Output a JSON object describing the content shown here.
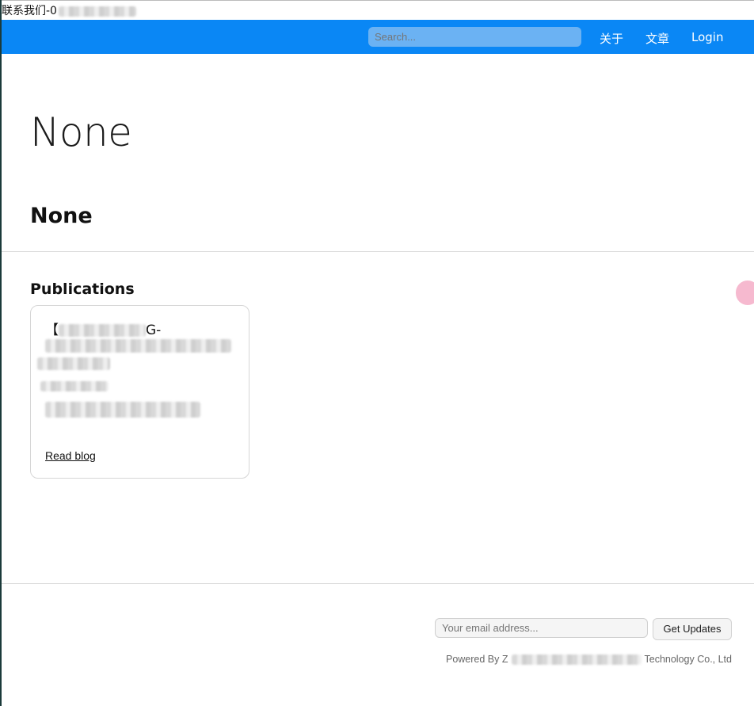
{
  "contact_bar": {
    "text": "联系我们-0"
  },
  "navbar": {
    "search_placeholder": "Search...",
    "links": [
      "关于",
      "文章",
      "Login"
    ]
  },
  "main": {
    "heading": "None",
    "subheading": "None",
    "publications_title": "Publications",
    "card": {
      "title_fragment_1": "【",
      "title_fragment_2": "G-",
      "read_link": "Read blog"
    }
  },
  "footer": {
    "email_placeholder": "Your email address...",
    "submit_label": "Get Updates",
    "powered_prefix": "Powered By Z",
    "powered_suffix": "Technology Co., Ltd"
  },
  "colors": {
    "navbar": "#0a87f5",
    "search_bg": "#6bb2f3",
    "side_widget": "#f6b9cf"
  }
}
